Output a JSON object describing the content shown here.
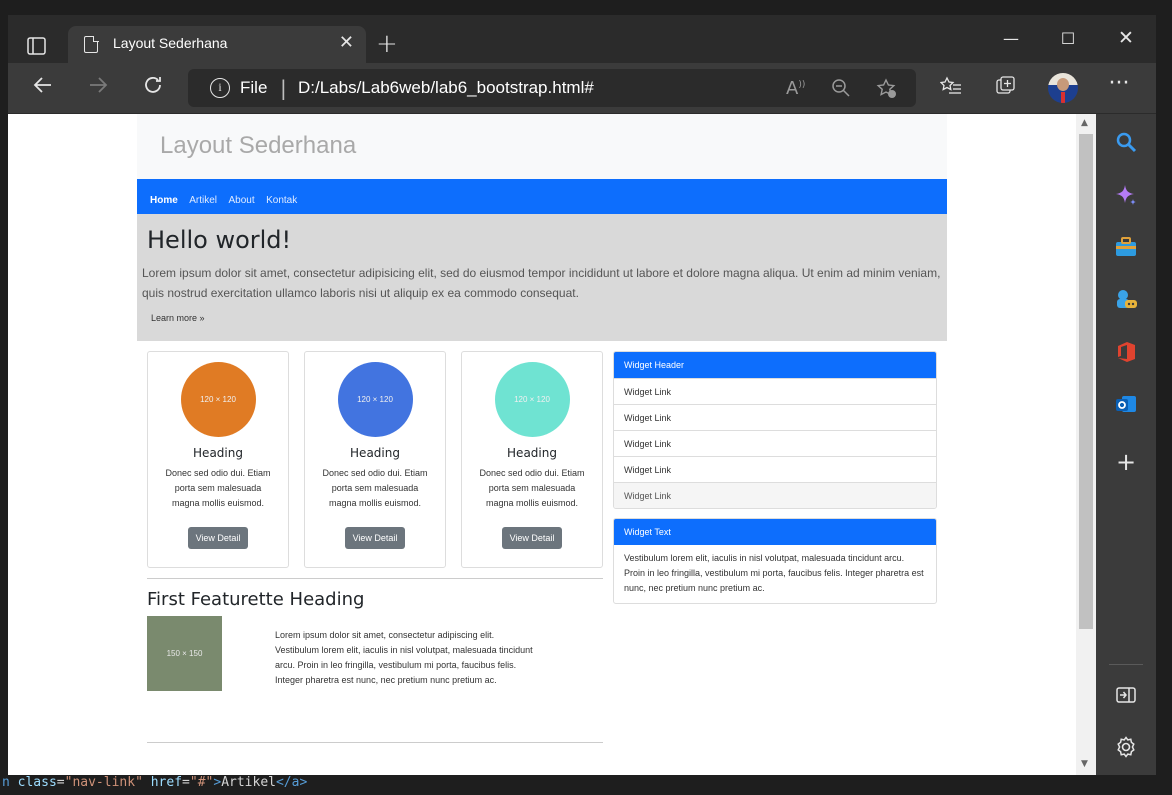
{
  "browser": {
    "tab_title": "Layout Sederhana",
    "address_scheme": "File",
    "address_url": "D:/Labs/Lab6web/lab6_bootstrap.html#"
  },
  "page": {
    "site_title": "Layout Sederhana",
    "nav": [
      "Home",
      "Artikel",
      "About",
      "Kontak"
    ],
    "hero": {
      "title": "Hello world!",
      "text": "Lorem ipsum dolor sit amet, consectetur adipisicing elit, sed do eiusmod tempor incididunt ut labore et dolore magna aliqua. Ut enim ad minim veniam, quis nostrud exercitation ullamco laboris nisi ut aliquip ex ea commodo consequat.",
      "button": "Learn more »"
    },
    "cards": [
      {
        "image": "120 × 120",
        "color": "#e07b24",
        "heading": "Heading",
        "text": "Donec sed odio dui. Etiam porta sem malesuada magna mollis euismod.",
        "button": "View Detail"
      },
      {
        "image": "120 × 120",
        "color": "#4274e0",
        "heading": "Heading",
        "text": "Donec sed odio dui. Etiam porta sem malesuada magna mollis euismod.",
        "button": "View Detail"
      },
      {
        "image": "120 × 120",
        "color": "#6fe3d2",
        "heading": "Heading",
        "text": "Donec sed odio dui. Etiam porta sem malesuada magna mollis euismod.",
        "button": "View Detail"
      }
    ],
    "widget_links": {
      "header": "Widget Header",
      "links": [
        "Widget Link",
        "Widget Link",
        "Widget Link",
        "Widget Link",
        "Widget Link"
      ]
    },
    "widget_text": {
      "header": "Widget Text",
      "body": "Vestibulum lorem elit, iaculis in nisl volutpat, malesuada tincidunt arcu. Proin in leo fringilla, vestibulum mi porta, faucibus felis. Integer pharetra est nunc, nec pretium nunc pretium ac."
    },
    "featurette": {
      "heading": "First Featurette Heading",
      "image": "150 × 150",
      "text": "Lorem ipsum dolor sit amet, consectetur adipiscing elit. Vestibulum lorem elit, iaculis in nisl volutpat, malesuada tincidunt arcu. Proin in leo fringilla, vestibulum mi porta, faucibus felis. Integer pharetra est nunc, nec pretium nunc pretium ac."
    }
  },
  "editor": {
    "bottom_line": {
      "prefix": "n ",
      "attr1": "class",
      "val1": "\"nav-link\"",
      "attr2": "href",
      "val2": "\"#\"",
      "text": "Artikel",
      "close": "</a>"
    }
  }
}
